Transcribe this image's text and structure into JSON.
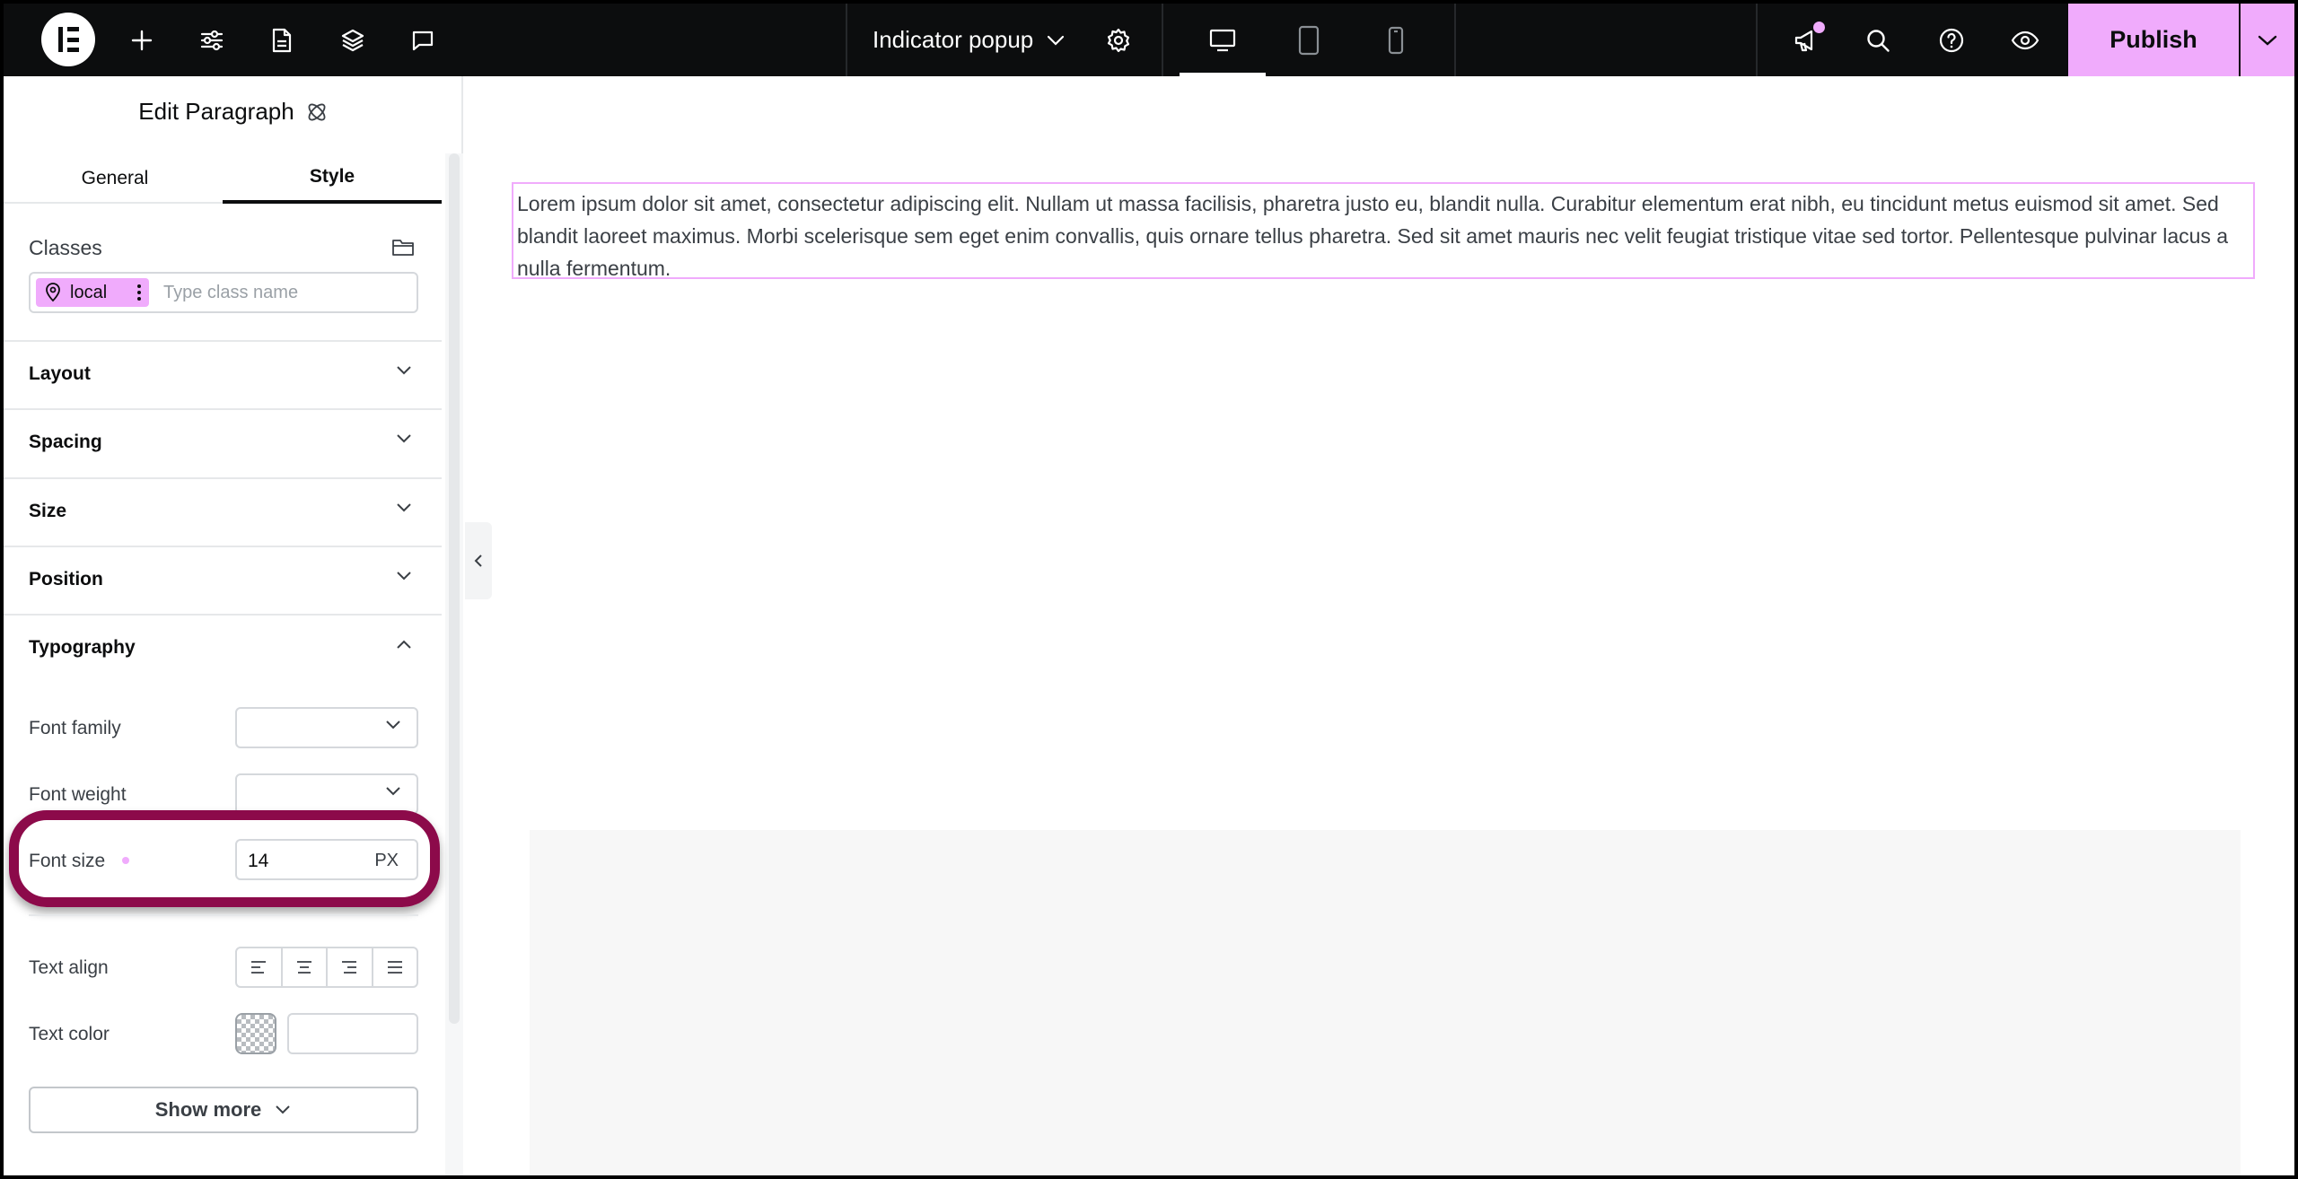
{
  "topbar": {
    "logo_icon": "elementor-logo-icon",
    "left_icons": [
      "plus-icon",
      "sliders-icon",
      "page-icon",
      "layers-icon",
      "comment-icon"
    ],
    "document_title": "Indicator popup",
    "right_icons": [
      "megaphone-icon",
      "search-icon",
      "help-icon",
      "eye-icon"
    ],
    "publish_label": "Publish",
    "accent_color": "#f0abfc"
  },
  "panel": {
    "title": "Edit Paragraph",
    "tabs": [
      {
        "label": "General"
      },
      {
        "label": "Style"
      }
    ],
    "classes": {
      "label": "Classes",
      "chip_label": "local",
      "placeholder": "Type class name"
    },
    "sections": [
      {
        "label": "Layout"
      },
      {
        "label": "Spacing"
      },
      {
        "label": "Size"
      },
      {
        "label": "Position"
      },
      {
        "label": "Typography"
      }
    ],
    "typography": {
      "font_family_label": "Font family",
      "font_weight_label": "Font weight",
      "font_size_label": "Font size",
      "font_size_value": "14",
      "font_size_unit": "PX",
      "text_align_label": "Text align",
      "text_color_label": "Text color"
    },
    "show_more_label": "Show more",
    "highlight_color": "#8c0a4a"
  },
  "canvas": {
    "paragraph": "Lorem ipsum dolor sit amet, consectetur adipiscing elit. Nullam ut massa facilisis, pharetra justo eu, blandit nulla. Curabitur elementum erat nibh, eu tincidunt metus euismod sit amet. Sed blandit laoreet maximus. Morbi scelerisque sem eget enim convallis, quis ornare tellus pharetra. Sed sit amet mauris nec velit feugiat tristique vitae sed tortor. Pellentesque pulvinar lacus a nulla fermentum."
  }
}
